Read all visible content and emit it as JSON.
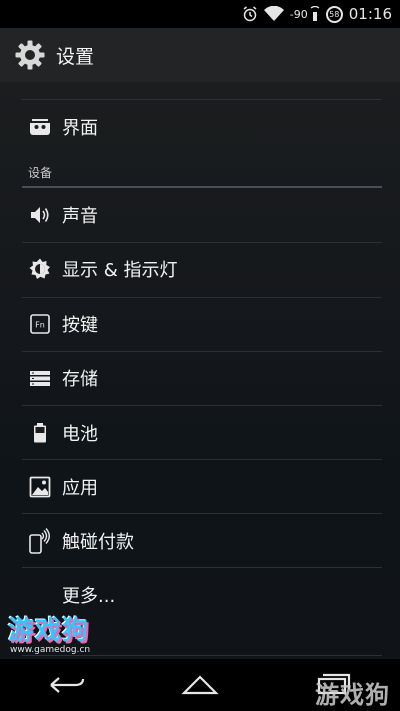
{
  "status_bar": {
    "signal_text": "-90",
    "battery_level": "58",
    "time": "01:16"
  },
  "action_bar": {
    "title": "设置"
  },
  "items_top": [
    {
      "label": "界面",
      "icon": "interface-icon"
    }
  ],
  "section_device": {
    "header": "设备",
    "items": [
      {
        "label": "声音",
        "icon": "volume-icon"
      },
      {
        "label": "显示 & 指示灯",
        "icon": "brightness-icon"
      },
      {
        "label": "按键",
        "icon": "fn-key-icon"
      },
      {
        "label": "存储",
        "icon": "storage-icon"
      },
      {
        "label": "电池",
        "icon": "battery-icon"
      },
      {
        "label": "应用",
        "icon": "apps-icon"
      },
      {
        "label": "触碰付款",
        "icon": "nfc-payment-icon"
      },
      {
        "label": "更多...",
        "icon": ""
      }
    ]
  },
  "watermark": {
    "logo_text": "游戏狗",
    "url": "www.gamedog.cn",
    "corner_text": "游戏狗"
  },
  "colors": {
    "background_top": "#1b1d1f",
    "background_bottom": "#101317",
    "action_bar": "#222426",
    "text": "#f2f2f2",
    "divider": "#2c3035"
  }
}
